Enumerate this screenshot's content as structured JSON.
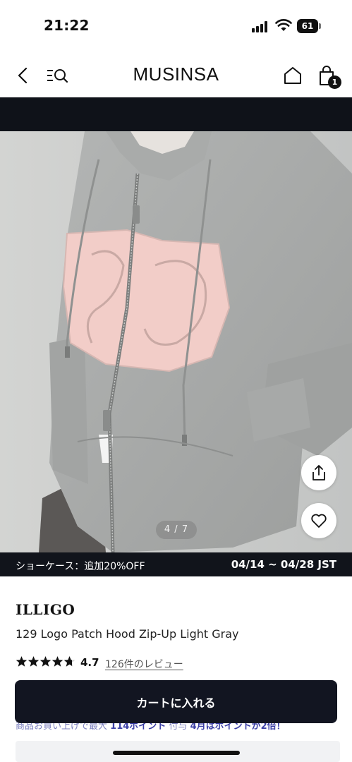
{
  "status_bar": {
    "time": "21:22",
    "battery": "61"
  },
  "header": {
    "brand": "MUSINSA",
    "cart_count": "1"
  },
  "gallery": {
    "pager": "4 / 7",
    "current": 4,
    "total": 7
  },
  "promo": {
    "label": "ショーケース：追加20%OFF",
    "dates": "04/14 ~ 04/28 JST"
  },
  "product": {
    "brand": "ILLIGO",
    "name": "129 Logo Patch Hood Zip-Up Light Gray",
    "rating": "4.7",
    "rating_value": 4.7,
    "reviews": "126件のレビュー"
  },
  "points": {
    "prefix": "商品お買い上げで最大",
    "amount": "114ポイント",
    "middle": "付与",
    "bonus": "4月はポイントが2倍！"
  },
  "cta": {
    "add_to_cart": "カートに入れる"
  },
  "colors": {
    "dark": "#11141b",
    "accent": "#3b3fa6",
    "hoodie": "#a8aaa9",
    "patch": "#f2cdc8"
  }
}
